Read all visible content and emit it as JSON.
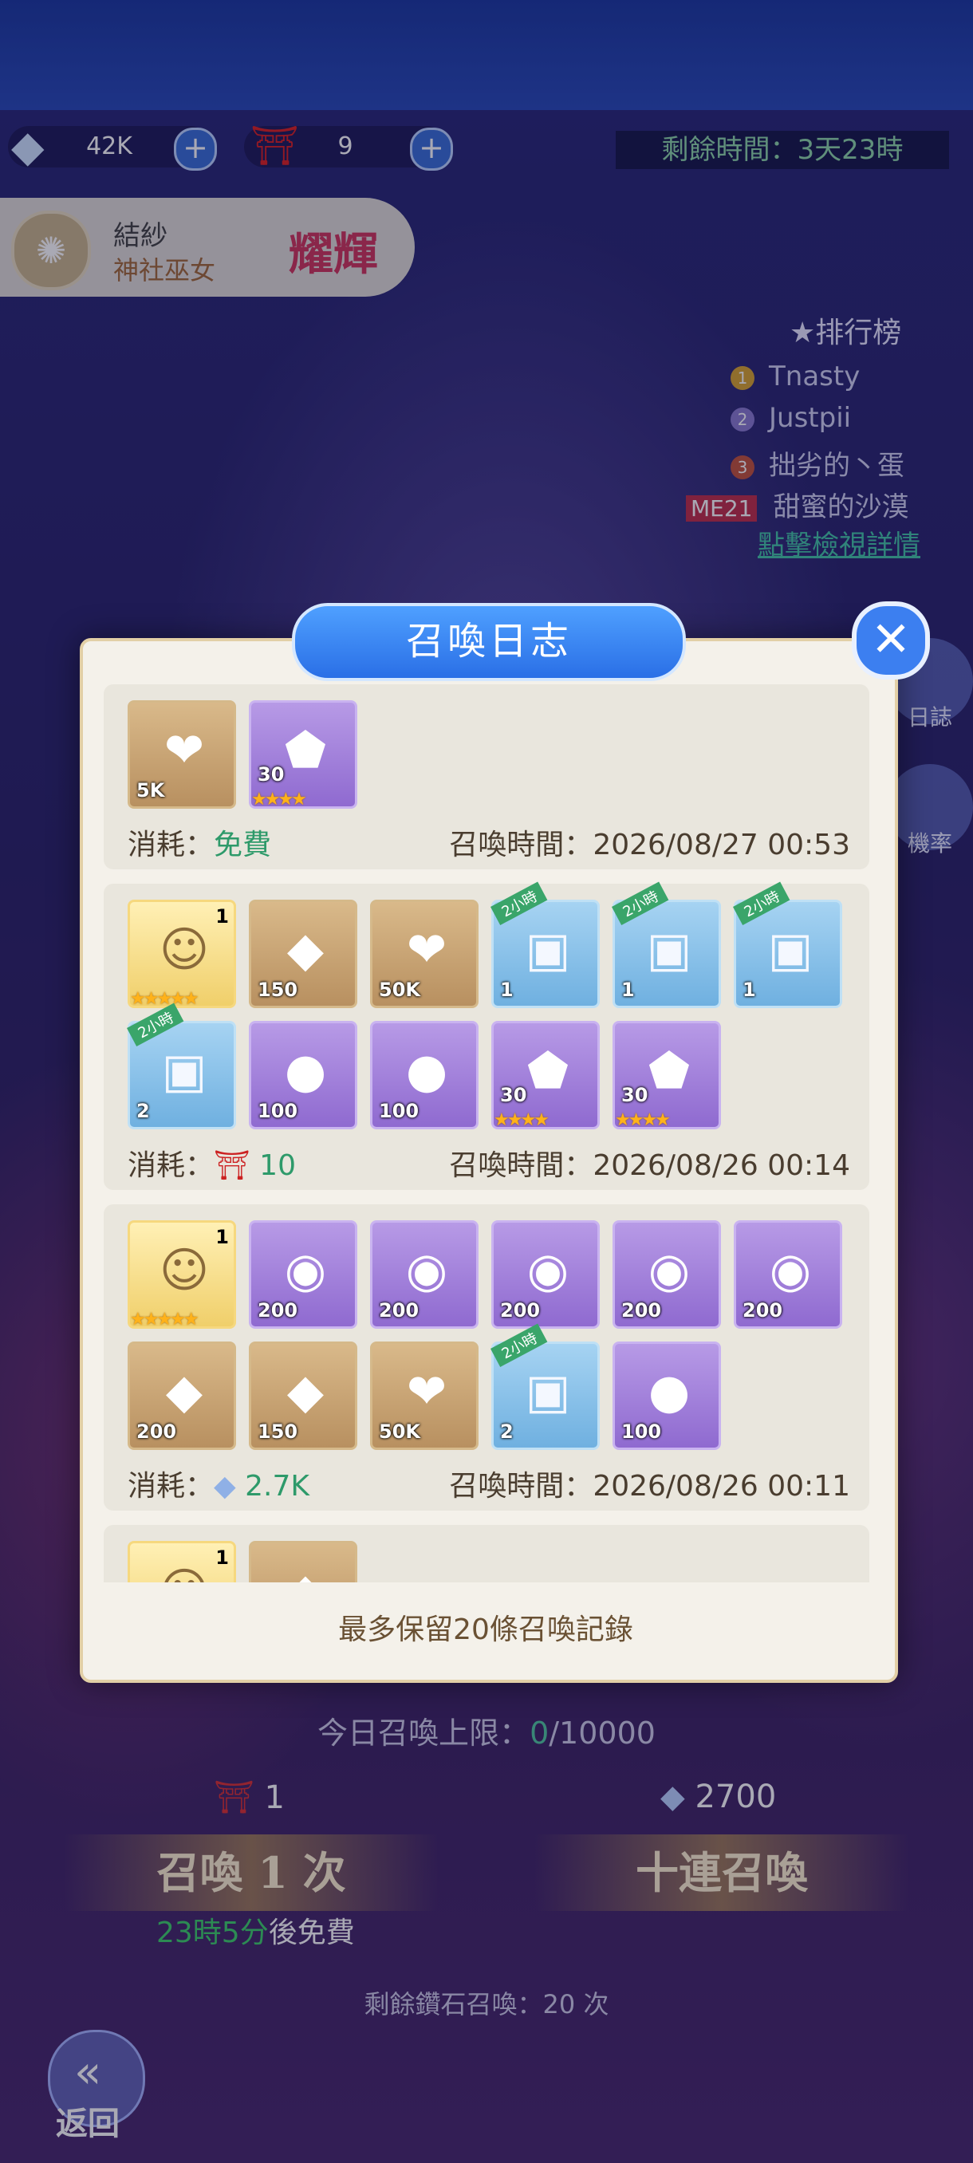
{
  "resources": {
    "diamonds": "42K",
    "tickets": "9"
  },
  "event_timer": "剩餘時間：3天23時",
  "banner": {
    "name": "結紗",
    "title": "神社巫女",
    "tag": "耀輝"
  },
  "ranking": {
    "title": "排行榜",
    "entries": [
      {
        "rank": "1",
        "name": "Tnasty"
      },
      {
        "rank": "2",
        "name": "Justpii"
      },
      {
        "rank": "3",
        "name": "拙劣的丶蛋"
      }
    ],
    "me": {
      "label": "ME21",
      "name": "甜蜜的沙漠"
    },
    "details_link": "點擊檢視詳情"
  },
  "side_buttons": [
    "日誌",
    "機率"
  ],
  "dialog": {
    "title": "召喚日志",
    "cost_label": "消耗：",
    "time_label": "召喚時間：",
    "footer": "最多保留20條召喚記錄",
    "entries": [
      {
        "items": [
          {
            "name": "exp-heart-icon",
            "glyph": "❤",
            "bg": "tan",
            "qty": "5K"
          },
          {
            "name": "purple-shard-icon",
            "glyph": "⬟",
            "bg": "purple",
            "qty": "30",
            "stars": "★★★★"
          }
        ],
        "cost": "免費",
        "time": "2026/08/27 00:53"
      },
      {
        "items": [
          {
            "name": "character-portrait-icon",
            "glyph": "☺",
            "bg": "gold",
            "qty_right": "1",
            "stars": "★★★★★"
          },
          {
            "name": "crystal-icon",
            "glyph": "◆",
            "bg": "tan",
            "qty": "150"
          },
          {
            "name": "exp-heart-icon",
            "glyph": "❤",
            "bg": "tan",
            "qty": "50K"
          },
          {
            "name": "treasure-chest-icon",
            "glyph": "▣",
            "bg": "blue",
            "qty": "1",
            "ribbon": "2小時"
          },
          {
            "name": "treasure-chest-icon",
            "glyph": "▣",
            "bg": "blue",
            "qty": "1",
            "ribbon": "2小時"
          },
          {
            "name": "treasure-chest-icon",
            "glyph": "▣",
            "bg": "blue",
            "qty": "1",
            "ribbon": "2小時"
          },
          {
            "name": "gold-chest-icon",
            "glyph": "▣",
            "bg": "blue",
            "qty": "2",
            "ribbon": "2小時"
          },
          {
            "name": "golden-egg-icon",
            "glyph": "●",
            "bg": "purple",
            "qty": "100"
          },
          {
            "name": "golden-egg-icon",
            "glyph": "●",
            "bg": "purple",
            "qty": "100"
          },
          {
            "name": "purple-shard-icon",
            "glyph": "⬟",
            "bg": "purple",
            "qty": "30",
            "stars": "★★★★"
          },
          {
            "name": "purple-shard-icon",
            "glyph": "⬟",
            "bg": "purple",
            "qty": "30",
            "stars": "★★★★"
          }
        ],
        "cost_value": "10",
        "cost_icon": "ticket",
        "time": "2026/08/26 00:14"
      },
      {
        "items": [
          {
            "name": "character-portrait-icon",
            "glyph": "☺",
            "bg": "gold",
            "qty_right": "1",
            "stars": "★★★★★"
          },
          {
            "name": "crystal-ball-icon",
            "glyph": "◉",
            "bg": "purple",
            "qty": "200"
          },
          {
            "name": "crystal-ball-icon",
            "glyph": "◉",
            "bg": "purple",
            "qty": "200"
          },
          {
            "name": "crystal-ball-icon",
            "glyph": "◉",
            "bg": "purple",
            "qty": "200"
          },
          {
            "name": "crystal-ball-icon",
            "glyph": "◉",
            "bg": "purple",
            "qty": "200"
          },
          {
            "name": "crystal-ball-icon",
            "glyph": "◉",
            "bg": "purple",
            "qty": "200"
          },
          {
            "name": "crystal-icon",
            "glyph": "◆",
            "bg": "tan",
            "qty": "200"
          },
          {
            "name": "crystal-icon",
            "glyph": "◆",
            "bg": "tan",
            "qty": "150"
          },
          {
            "name": "exp-heart-icon",
            "glyph": "❤",
            "bg": "tan",
            "qty": "50K"
          },
          {
            "name": "gold-chest-icon",
            "glyph": "▣",
            "bg": "blue",
            "qty": "2",
            "ribbon": "2小時"
          },
          {
            "name": "golden-egg-icon",
            "glyph": "●",
            "bg": "purple",
            "qty": "100"
          }
        ],
        "cost_value": "2.7K",
        "cost_icon": "diamond",
        "time": "2026/08/26 00:11"
      },
      {
        "items": [
          {
            "name": "character-portrait-icon",
            "glyph": "☺",
            "bg": "gold",
            "qty_right": "1"
          },
          {
            "name": "crystal-icon",
            "glyph": "◆",
            "bg": "tan"
          }
        ]
      }
    ]
  },
  "summon": {
    "daily_limit_label": "今日召喚上限：",
    "daily_limit_used": "0",
    "daily_limit_max": "/10000",
    "single_cost": "1",
    "multi_cost": "2700",
    "single_label": "召喚 1 次",
    "multi_label": "十連召喚",
    "free_in_value": "23時5分",
    "free_in_suffix": "後免費",
    "remaining": "剩餘鑽石召喚：20 次"
  },
  "back_label": "返回"
}
